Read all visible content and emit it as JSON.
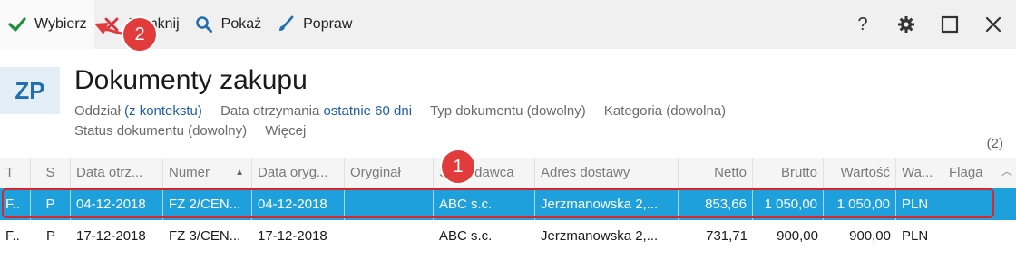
{
  "toolbar": {
    "buttons": [
      {
        "label": "Wybierz",
        "icon": "check-icon"
      },
      {
        "label": "Zamknij",
        "icon": "close-x-icon"
      },
      {
        "label": "Pokaż",
        "icon": "search-icon"
      },
      {
        "label": "Popraw",
        "icon": "brush-icon"
      }
    ],
    "right_icons": [
      "help-icon",
      "settings-gear-icon",
      "maximize-icon",
      "close-window-icon"
    ],
    "help_glyph": "?"
  },
  "header": {
    "badge": "ZP",
    "title": "Dokumenty zakupu",
    "filters": [
      {
        "label": "Oddział",
        "value": "(z kontekstu)"
      },
      {
        "label": "Data otrzymania",
        "value": "ostatnie 60 dni"
      },
      {
        "label": "Typ dokumentu (dowolny)",
        "value": ""
      },
      {
        "label": "Kategoria (dowolna)",
        "value": ""
      },
      {
        "label": "Status dokumentu (dowolny)",
        "value": ""
      },
      {
        "label": "Więcej",
        "value": ""
      }
    ],
    "count": "(2)"
  },
  "table": {
    "columns": [
      "T",
      "S",
      "Data otrz...",
      "Numer",
      "Data oryg...",
      "Oryginał",
      "Sprzedawca",
      "Adres dostawy",
      "Netto",
      "Brutto",
      "Wartość",
      "Wa...",
      "Flaga"
    ],
    "rows": [
      [
        "F..",
        "P",
        "04-12-2018",
        "FZ 2/CEN...",
        "04-12-2018",
        "",
        "ABC s.c.",
        "Jerzmanowska 2,...",
        "853,66",
        "1 050,00",
        "1 050,00",
        "PLN",
        ""
      ],
      [
        "F..",
        "P",
        "17-12-2018",
        "FZ 3/CEN...",
        "17-12-2018",
        "",
        "ABC s.c.",
        "Jerzmanowska 2,...",
        "731,71",
        "900,00",
        "900,00",
        "PLN",
        ""
      ]
    ]
  },
  "annotations": {
    "marker1": "1",
    "marker2": "2",
    "color": "#e23b3b"
  },
  "colors": {
    "selection": "#1ea0dc",
    "accent_link": "#1f5fa8",
    "check": "#1f8f3a",
    "close_x": "#d9343b",
    "icon_blue": "#1f6fb2"
  }
}
